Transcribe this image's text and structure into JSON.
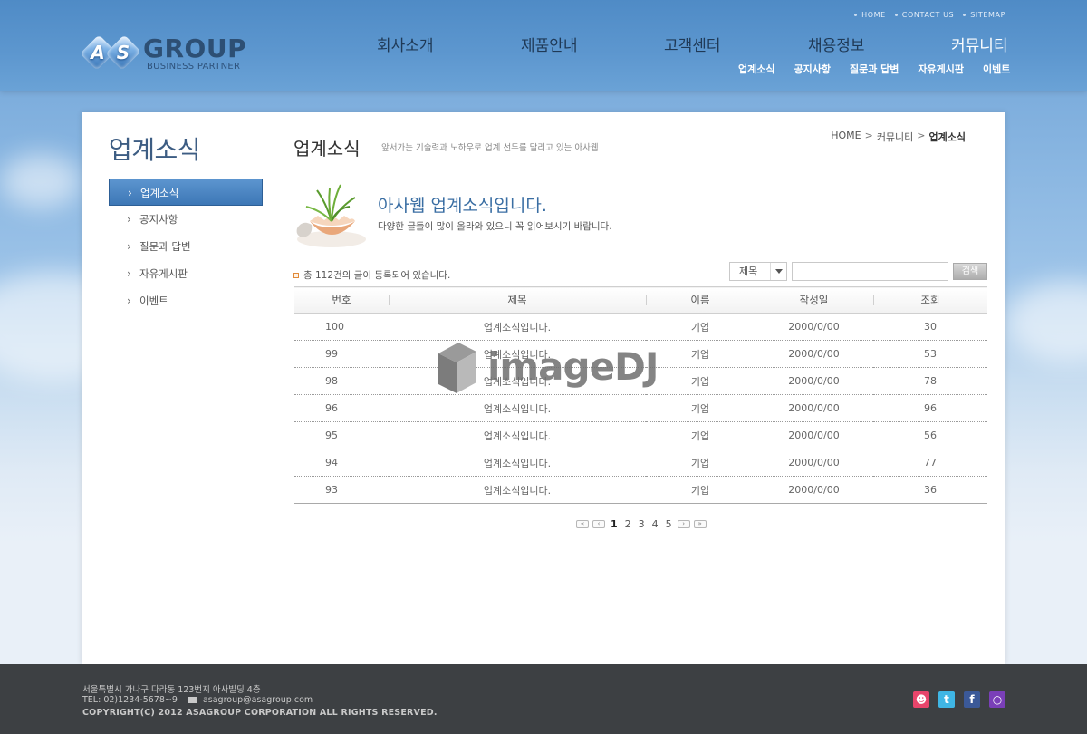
{
  "header": {
    "util_links": [
      "HOME",
      "CONTACT US",
      "SITEMAP"
    ],
    "logo": {
      "letter1": "A",
      "letter2": "S",
      "word": "GROUP",
      "tagline": "BUSINESS PARTNER"
    },
    "menu": [
      "회사소개",
      "제품안내",
      "고객센터",
      "채용정보",
      "커뮤니티"
    ],
    "submenu": [
      "업계소식",
      "공지사항",
      "질문과 답변",
      "자유게시판",
      "이벤트"
    ]
  },
  "sidebar": {
    "title": "업계소식",
    "items": [
      {
        "label": "업계소식",
        "active": true
      },
      {
        "label": "공지사항",
        "active": false
      },
      {
        "label": "질문과 답변",
        "active": false
      },
      {
        "label": "자유게시판",
        "active": false
      },
      {
        "label": "이벤트",
        "active": false
      }
    ]
  },
  "main": {
    "title": "업계소식",
    "description": "앞서가는 기술력과 노하우로 업계 선두를 달리고 있는 아사웹",
    "breadcrumb": [
      "HOME",
      "커뮤니티",
      "업계소식"
    ],
    "intro": {
      "title": "아사웹 업계소식입니다.",
      "subtitle": "다양한 글들이 많이 올라와 있으니 꼭 읽어보시기 바랍니다."
    },
    "count_text": "총 112건의 글이 등록되어 있습니다.",
    "search": {
      "select_value": "제목",
      "input_value": "",
      "button_label": "검색"
    },
    "table": {
      "headers": [
        "번호",
        "제목",
        "이름",
        "작성일",
        "조회"
      ],
      "rows": [
        [
          "100",
          "업계소식입니다.",
          "기업",
          "2000/0/00",
          "30"
        ],
        [
          "99",
          "업계소식입니다.",
          "기업",
          "2000/0/00",
          "53"
        ],
        [
          "98",
          "업계소식입니다.",
          "기업",
          "2000/0/00",
          "78"
        ],
        [
          "96",
          "업계소식입니다.",
          "기업",
          "2000/0/00",
          "96"
        ],
        [
          "95",
          "업계소식입니다.",
          "기업",
          "2000/0/00",
          "56"
        ],
        [
          "94",
          "업계소식입니다.",
          "기업",
          "2000/0/00",
          "77"
        ],
        [
          "93",
          "업계소식입니다.",
          "기업",
          "2000/0/00",
          "36"
        ]
      ]
    },
    "pagination": {
      "pages": [
        "1",
        "2",
        "3",
        "4",
        "5"
      ],
      "current": "1"
    },
    "watermark": "imageDJ"
  },
  "footer": {
    "address": "서울특별시 가나구 다라동 123번지 아사빌딩 4층",
    "tel": "TEL: 02)1234-5678~9",
    "email": "asagroup@asagroup.com",
    "copyright": "COPYRIGHT(C) 2012 ASAGROUP CORPORATION ALL RIGHTS RESERVED.",
    "sns": [
      {
        "name": "cyworld-icon",
        "color": "#e8456b"
      },
      {
        "name": "twitter-icon",
        "color": "#3fb6e5"
      },
      {
        "name": "facebook-icon",
        "color": "#3b5998"
      },
      {
        "name": "me2day-icon",
        "color": "#7a3fb8"
      }
    ]
  }
}
